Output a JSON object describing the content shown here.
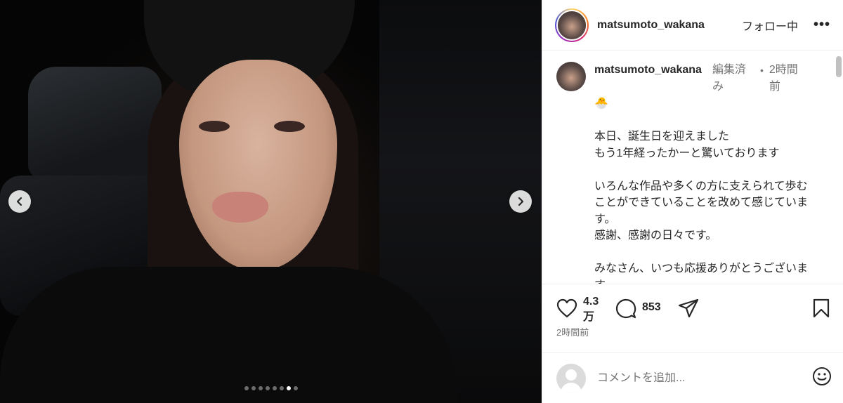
{
  "media": {
    "carousel": {
      "total_slides": 8,
      "active_slide": 7
    },
    "prev_icon": "chevron-left-icon",
    "next_icon": "chevron-right-icon"
  },
  "header": {
    "username": "matsumoto_wakana",
    "follow_label": "フォロー中",
    "more_label": "•••"
  },
  "caption": {
    "username": "matsumoto_wakana",
    "edited_label": "編集済み",
    "separator": "•",
    "time": "2時間前",
    "text": "🐣\n\n本日、誕生日を迎えました\nもう1年経ったかーと驚いております\n\nいろんな作品や多くの方に支えられて歩むことができていることを改めて感じています。\n感謝、感謝の日々です。\n\nみなさん、いつも応援ありがとうございます。"
  },
  "actions": {
    "like_icon": "heart-icon",
    "like_count": "4.3万",
    "comment_icon": "comment-icon",
    "comment_count": "853",
    "share_icon": "send-icon",
    "save_icon": "bookmark-icon",
    "timestamp": "2時間前"
  },
  "comment_bar": {
    "placeholder": "コメントを追加...",
    "emoji_icon": "smiley-icon"
  }
}
